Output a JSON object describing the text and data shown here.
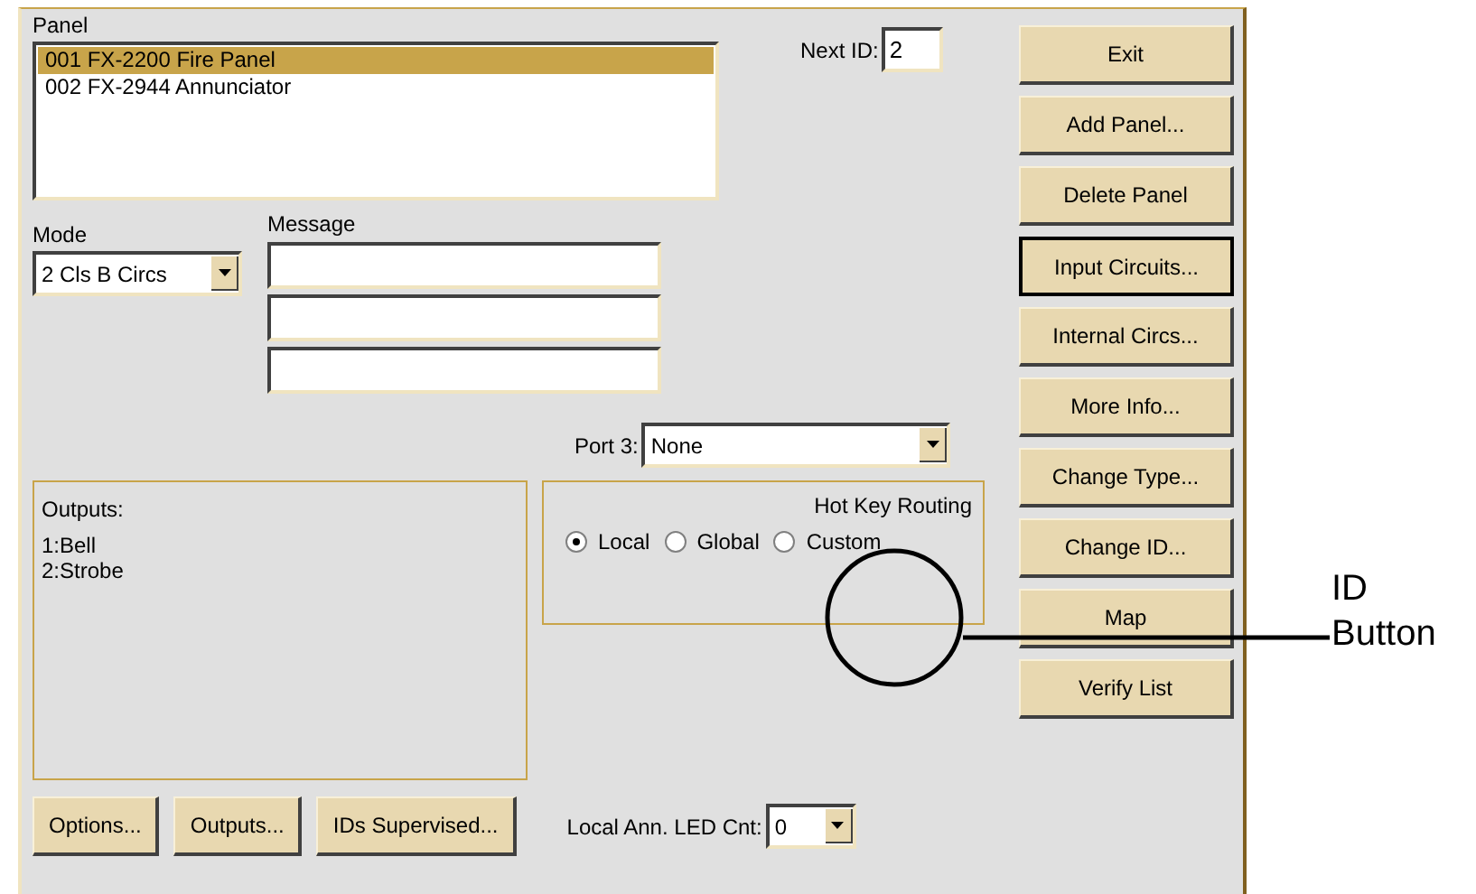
{
  "panel_list": {
    "label": "Panel",
    "items": [
      {
        "text": "001 FX-2200 Fire Panel",
        "selected": true
      },
      {
        "text": "002 FX-2944 Annunciator",
        "selected": false
      }
    ]
  },
  "next_id": {
    "label": "Next ID:",
    "value": "2"
  },
  "mode": {
    "label": "Mode",
    "value": "2 Cls B Circs"
  },
  "message": {
    "label": "Message",
    "fields": [
      {
        "kind": "text"
      },
      {
        "kind": "text"
      },
      {
        "kind": "text"
      }
    ]
  },
  "port3": {
    "label": "Port 3:",
    "value": "None"
  },
  "outputs": {
    "title": "Outputs:",
    "lines": [
      "1:Bell",
      "2:Strobe"
    ]
  },
  "hot_key_routing": {
    "title": "Hot Key Routing",
    "options": [
      {
        "label": "Local",
        "selected": true
      },
      {
        "label": "Global",
        "selected": false
      },
      {
        "label": "Custom",
        "selected": false
      }
    ]
  },
  "bottom_buttons": [
    {
      "label": "Options..."
    },
    {
      "label": "Outputs..."
    },
    {
      "label": "IDs Supervised..."
    }
  ],
  "led_count": {
    "label": "Local Ann. LED Cnt:",
    "value": "0"
  },
  "side_buttons": [
    {
      "label": "Exit",
      "focused": false
    },
    {
      "label": "Add Panel...",
      "focused": false
    },
    {
      "label": "Delete Panel",
      "focused": false
    },
    {
      "label": "Input Circuits...",
      "focused": true
    },
    {
      "label": "Internal Circs...",
      "focused": false
    },
    {
      "label": "More Info...",
      "focused": false
    },
    {
      "label": "Change Type...",
      "focused": false
    },
    {
      "label": "Change ID...",
      "focused": false
    },
    {
      "label": "Map",
      "focused": false
    },
    {
      "label": "Verify List",
      "focused": false
    }
  ],
  "callout": {
    "label": "ID Button"
  }
}
